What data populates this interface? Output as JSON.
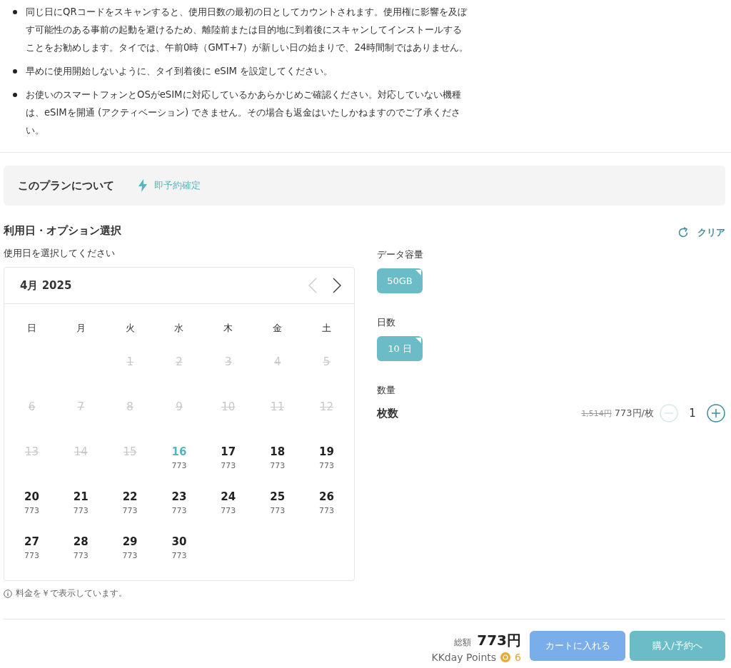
{
  "notes": [
    "同じ日にQRコードをスキャンすると、使用日数の最初の日としてカウントされます。使用権に影響を及ぼす可能性のある事前の起動を避けるため、離陸前または目的地に到着後にスキャンしてインストールすることをお勧めします。タイでは、午前0時（GMT+7）が新しい日の始まりで、24時間制ではありません。",
    "早めに使用開始しないように、タイ到着後に eSIM を設定してください。",
    "お使いのスマートフォンとOSがeSIMに対応しているかあらかじめご確認ください。対応していない機種は、eSIMを開通 (アクティベーション) できません。その場合も返金はいたしかねますのでご了承ください。"
  ],
  "plan_bar": {
    "title": "このプランについて",
    "badge": "即予約確定"
  },
  "selection": {
    "title": "利用日・オプション選択",
    "clear": "クリア",
    "date_label": "使用日を選択してください",
    "calendar": {
      "month": "4月 2025",
      "prev_disabled": true,
      "weekdays": [
        "日",
        "月",
        "火",
        "水",
        "木",
        "金",
        "土"
      ],
      "weeks": [
        {
          "kind": "right",
          "days": [
            {
              "day": "1",
              "disabled": true,
              "selected": false
            },
            {
              "day": "2",
              "disabled": true,
              "selected": false
            },
            {
              "day": "3",
              "disabled": true,
              "selected": false
            },
            {
              "day": "4",
              "disabled": true,
              "selected": false
            },
            {
              "day": "5",
              "disabled": true,
              "selected": false
            }
          ]
        },
        {
          "kind": "left",
          "days": [
            {
              "day": "6",
              "disabled": true,
              "selected": false
            },
            {
              "day": "7",
              "disabled": true,
              "selected": false
            },
            {
              "day": "8",
              "disabled": true,
              "selected": false
            },
            {
              "day": "9",
              "disabled": true,
              "selected": false
            },
            {
              "day": "10",
              "disabled": true,
              "selected": false
            },
            {
              "day": "11",
              "disabled": true,
              "selected": false
            },
            {
              "day": "12",
              "disabled": true,
              "selected": false
            }
          ]
        },
        {
          "kind": "left",
          "days": [
            {
              "day": "13",
              "disabled": true,
              "selected": false
            },
            {
              "day": "14",
              "disabled": true,
              "selected": false
            },
            {
              "day": "15",
              "disabled": true,
              "selected": false
            },
            {
              "day": "16",
              "disabled": false,
              "selected": true,
              "price": "773"
            },
            {
              "day": "17",
              "disabled": false,
              "selected": false,
              "price": "773"
            },
            {
              "day": "18",
              "disabled": false,
              "selected": false,
              "price": "773"
            },
            {
              "day": "19",
              "disabled": false,
              "selected": false,
              "price": "773"
            }
          ]
        },
        {
          "kind": "left",
          "days": [
            {
              "day": "20",
              "disabled": false,
              "selected": false,
              "price": "773"
            },
            {
              "day": "21",
              "disabled": false,
              "selected": false,
              "price": "773"
            },
            {
              "day": "22",
              "disabled": false,
              "selected": false,
              "price": "773"
            },
            {
              "day": "23",
              "disabled": false,
              "selected": false,
              "price": "773"
            },
            {
              "day": "24",
              "disabled": false,
              "selected": false,
              "price": "773"
            },
            {
              "day": "25",
              "disabled": false,
              "selected": false,
              "price": "773"
            },
            {
              "day": "26",
              "disabled": false,
              "selected": false,
              "price": "773"
            }
          ]
        },
        {
          "kind": "left",
          "days": [
            {
              "day": "27",
              "disabled": false,
              "selected": false,
              "price": "773"
            },
            {
              "day": "28",
              "disabled": false,
              "selected": false,
              "price": "773"
            },
            {
              "day": "29",
              "disabled": false,
              "selected": false,
              "price": "773"
            },
            {
              "day": "30",
              "disabled": false,
              "selected": false,
              "price": "773"
            }
          ]
        }
      ]
    },
    "currency_note": "料金を￥で表示しています。",
    "options": [
      {
        "label": "データ容量",
        "chips": [
          {
            "text": "50GB",
            "selected": true
          }
        ]
      },
      {
        "label": "日数",
        "chips": [
          {
            "text": "10 日",
            "selected": true
          }
        ]
      }
    ],
    "quantity": {
      "label": "数量",
      "item": "枚数",
      "old_price": "1,514円",
      "price": "773円/枚",
      "count": "1",
      "minus_disabled": true
    }
  },
  "footer": {
    "total_label": "総額",
    "total": "773円",
    "points_label": "KKday Points",
    "points": "6",
    "cart": "カートに入れる",
    "buy": "購入/予約へ"
  }
}
